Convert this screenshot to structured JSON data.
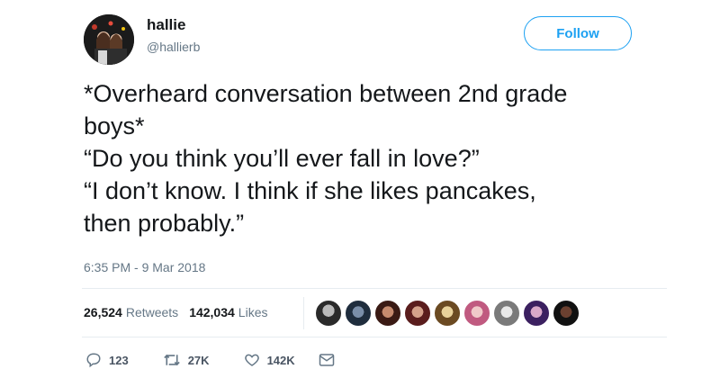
{
  "user": {
    "name": "hallie",
    "handle": "@hallierb"
  },
  "follow_button": "Follow",
  "tweet": {
    "lines": [
      "*Overheard conversation between 2nd grade",
      "boys*",
      "“Do you think you’ll ever fall in love?”",
      "“I don’t know. I think if she likes pancakes,",
      "then probably.”"
    ],
    "timestamp": "6:35 PM - 9 Mar 2018"
  },
  "stats": {
    "retweets": "26,524",
    "retweets_label": "Retweets",
    "likes": "142,034",
    "likes_label": "Likes"
  },
  "actions": {
    "replies": "123",
    "retweets": "27K",
    "likes": "142K"
  },
  "colors": {
    "accent": "#1da1f2",
    "secondary_text": "#657786",
    "divider": "#e6ecf0"
  },
  "icons": [
    "reply-icon",
    "retweet-icon",
    "heart-icon",
    "message-icon"
  ]
}
